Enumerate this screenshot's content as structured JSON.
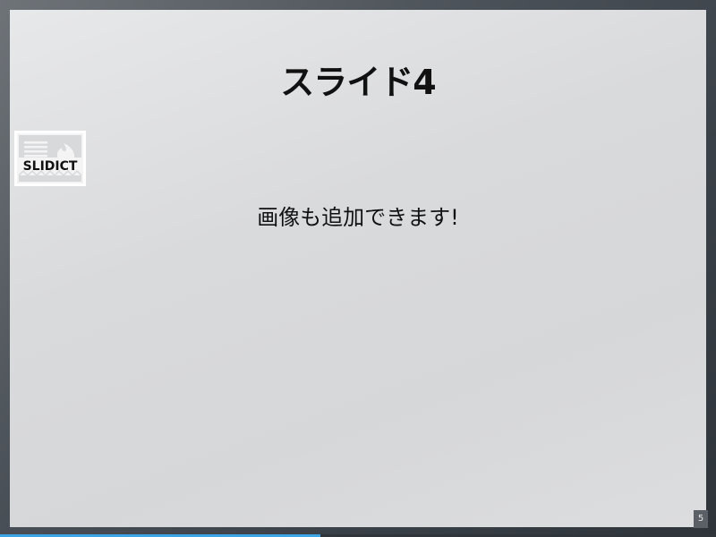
{
  "slide": {
    "title": "スライド4",
    "body": "画像も追加できます!",
    "logo_text": "SLIDICT",
    "logo_icon": "document-fire-icon"
  },
  "pagination": {
    "page_number": "5",
    "progress_fraction": 0.447
  },
  "colors": {
    "progress_fill": "#3da4e6",
    "background_dark": "#3a4047",
    "slide_background": "#dcdddf"
  }
}
